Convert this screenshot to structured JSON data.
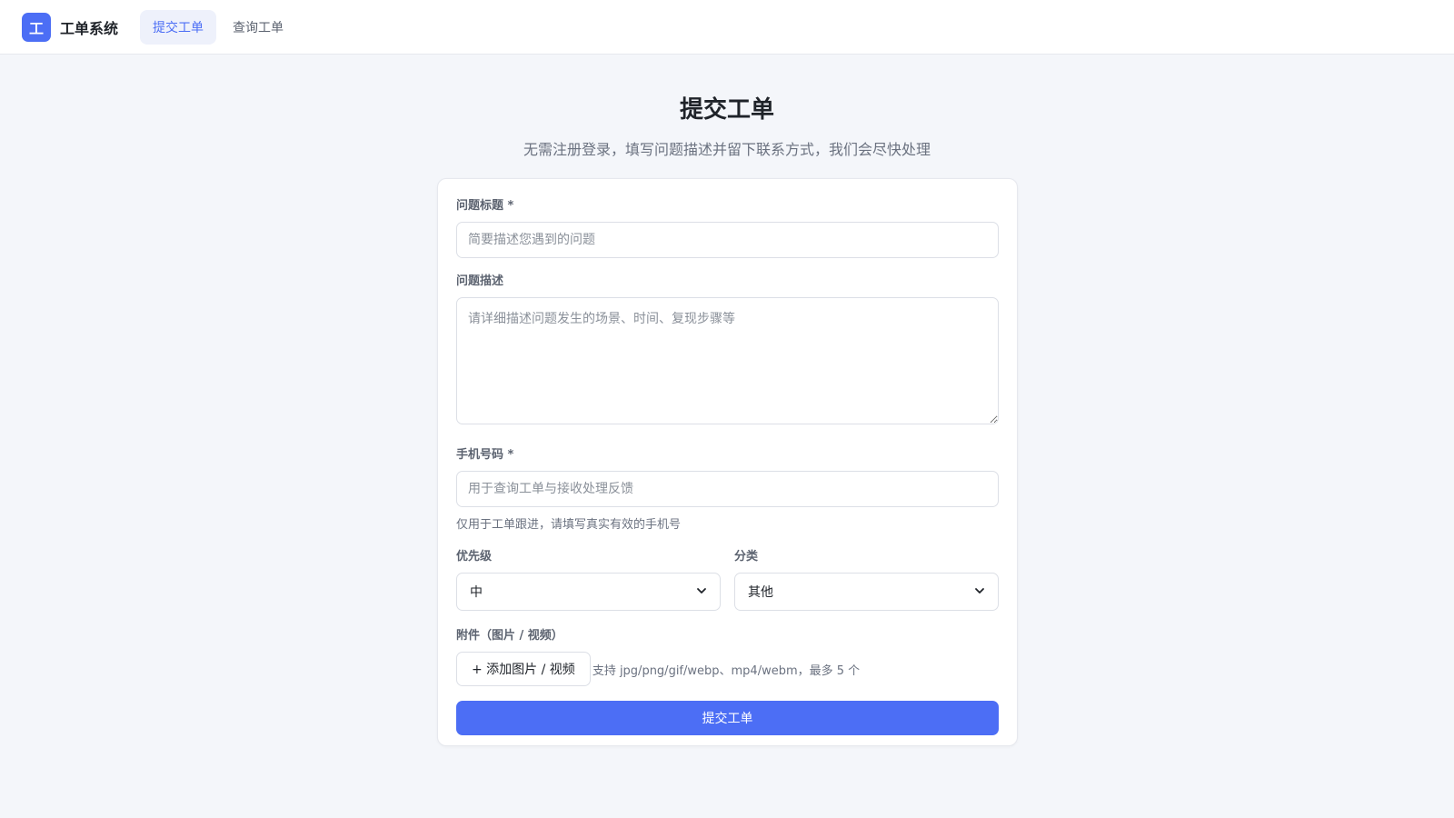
{
  "nav": {
    "logo_char": "工",
    "brand": "工单系统",
    "tabs": [
      {
        "label": "提交工单",
        "active": true
      },
      {
        "label": "查询工单",
        "active": false
      }
    ]
  },
  "page": {
    "title": "提交工单",
    "subtitle": "无需注册登录，填写问题描述并留下联系方式，我们会尽快处理"
  },
  "form": {
    "title_field": {
      "label": "问题标题 *",
      "placeholder": "简要描述您遇到的问题",
      "value": ""
    },
    "description_field": {
      "label": "问题描述",
      "placeholder": "请详细描述问题发生的场景、时间、复现步骤等",
      "value": ""
    },
    "phone_field": {
      "label": "手机号码 *",
      "placeholder": "用于查询工单与接收处理反馈",
      "value": "",
      "hint": "仅用于工单跟进，请填写真实有效的手机号"
    },
    "priority_field": {
      "label": "优先级",
      "selected": "中"
    },
    "category_field": {
      "label": "分类",
      "selected": "其他"
    },
    "attachment_field": {
      "label": "附件（图片 / 视频）",
      "button_label": "+ 添加图片 / 视频",
      "hint": "支持 jpg/png/gif/webp、mp4/webm，最多 5 个"
    },
    "submit_label": "提交工单"
  },
  "colors": {
    "accent": "#4c6ef5",
    "background": "#f4f6fa",
    "active_tab_bg": "#eef1fb"
  }
}
